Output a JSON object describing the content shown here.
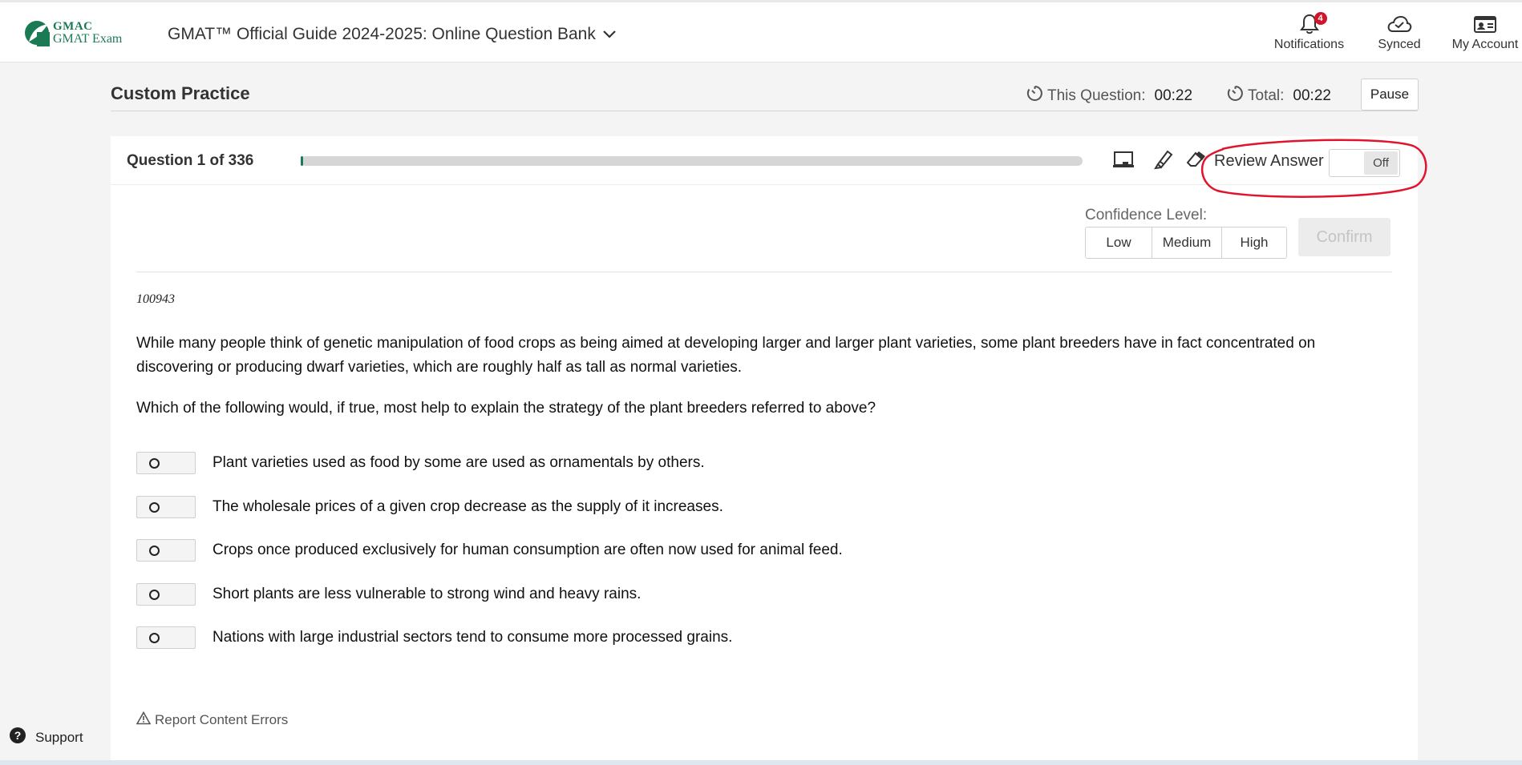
{
  "header": {
    "logo_line1": "GMAC",
    "logo_line2": "GMAT Exam",
    "guide_title": "GMAT™ Official Guide 2024-2025: Online Question Bank",
    "notifications": {
      "label": "Notifications",
      "count": "4"
    },
    "synced_label": "Synced",
    "account_label": "My Account"
  },
  "practice": {
    "title": "Custom Practice",
    "this_question_label": "This Question:",
    "this_question_time": "00:22",
    "total_label": "Total:",
    "total_time": "00:22",
    "pause_label": "Pause"
  },
  "question": {
    "counter": "Question 1 of 336",
    "progress_fraction": 0.003,
    "review_answer_label": "Review Answer",
    "review_toggle_state": "Off",
    "confidence_label": "Confidence Level:",
    "confidence_options": [
      "Low",
      "Medium",
      "High"
    ],
    "confirm_label": "Confirm",
    "id": "100943",
    "stem": "While many people think of genetic manipulation of food crops as being aimed at developing larger and larger plant varieties, some plant breeders have in fact concentrated on discovering or producing dwarf varieties, which are roughly half as tall as normal varieties.",
    "prompt": "Which of the following would, if true, most help to explain the strategy of the plant breeders referred to above?",
    "choices": [
      "Plant varieties used as food by some are used as ornamentals by others.",
      "The wholesale prices of a given crop decrease as the supply of it increases.",
      "Crops once produced exclusively for human consumption are often now used for animal feed.",
      "Short plants are less vulnerable to strong wind and heavy rains.",
      "Nations with large industrial sectors tend to consume more processed grains."
    ],
    "report_label": "Report Content Errors"
  },
  "support_label": "Support",
  "colors": {
    "brand_green": "#1a7a53",
    "badge_red": "#d0142c",
    "annotation_red": "#e0142c"
  },
  "icons": [
    "bell-icon",
    "cloud-sync-icon",
    "account-card-icon",
    "chevron-down-icon",
    "timer-icon",
    "whiteboard-icon",
    "highlighter-icon",
    "eraser-icon",
    "warning-icon",
    "help-circle-icon"
  ]
}
